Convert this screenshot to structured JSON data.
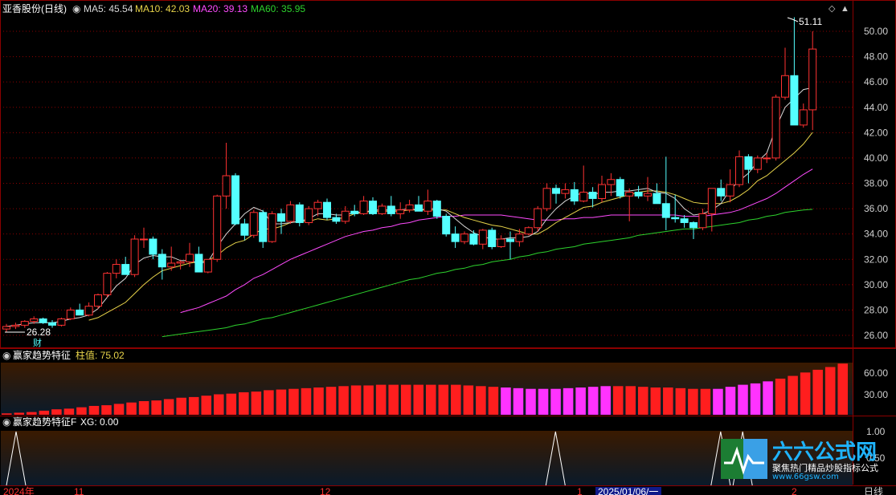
{
  "stock_name": "亚香股份(日线)",
  "colors": {
    "up": "#ff3232",
    "down": "#54ffff",
    "ma5": "#d8d8d8",
    "ma10": "#e8d44a",
    "ma20": "#ff4bff",
    "ma60": "#2dd22d",
    "grid": "#8b0000",
    "bar_red": "#ff1e1e",
    "bar_magenta": "#ff33ff"
  },
  "main_indicator": {
    "ma5_label": "MA5: 45.54",
    "ma10_label": "MA10: 42.03",
    "ma20_label": "MA20: 39.13",
    "ma60_label": "MA60: 35.95"
  },
  "price_axis": [
    "50.00",
    "48.00",
    "46.00",
    "44.00",
    "42.00",
    "40.00",
    "38.00",
    "36.00",
    "34.00",
    "32.00",
    "30.00",
    "28.00",
    "26.00"
  ],
  "high_marker": "51.11",
  "low_marker": "26.28",
  "caifu_label": "财",
  "panel2": {
    "title": "赢家趋势特征",
    "value_label": "柱值: 75.02",
    "axis": [
      "60.00",
      "30.00"
    ]
  },
  "panel3": {
    "title": "赢家趋势特征F",
    "value_label": "XG: 0.00",
    "axis": [
      "1.00",
      "0.50"
    ]
  },
  "time_axis": {
    "year": "2024年",
    "m11": "11",
    "m12": "12",
    "m1": "1",
    "current_date": "2025/01/06/一",
    "m2": "2",
    "period": "日线"
  },
  "brand": {
    "name": "六六公式网",
    "slogan": "聚焦热门精品炒股指标公式",
    "url": "www.66gsw.com"
  },
  "chart_data": {
    "type": "candlestick",
    "ohlc": [
      [
        26.5,
        26.9,
        26.28,
        26.7
      ],
      [
        26.7,
        27.0,
        26.5,
        26.8
      ],
      [
        26.8,
        27.2,
        26.6,
        27.1
      ],
      [
        27.1,
        27.5,
        26.9,
        27.3
      ],
      [
        27.3,
        27.4,
        26.9,
        27.0
      ],
      [
        27.0,
        27.2,
        26.6,
        26.8
      ],
      [
        26.8,
        27.4,
        26.7,
        27.3
      ],
      [
        27.3,
        28.2,
        27.2,
        28.0
      ],
      [
        28.0,
        28.5,
        27.8,
        27.6
      ],
      [
        27.6,
        28.6,
        27.5,
        28.3
      ],
      [
        28.3,
        29.3,
        28.1,
        29.2
      ],
      [
        29.2,
        31.0,
        29.0,
        30.9
      ],
      [
        30.9,
        32.0,
        30.5,
        31.6
      ],
      [
        31.6,
        32.2,
        31.0,
        30.8
      ],
      [
        30.8,
        33.9,
        30.6,
        33.6
      ],
      [
        33.6,
        34.5,
        32.9,
        33.6
      ],
      [
        33.6,
        33.8,
        32.0,
        32.4
      ],
      [
        32.4,
        32.8,
        30.4,
        31.4
      ],
      [
        31.4,
        33.0,
        31.1,
        31.7
      ],
      [
        31.7,
        31.9,
        31.2,
        31.8
      ],
      [
        31.8,
        33.3,
        31.4,
        32.4
      ],
      [
        32.4,
        33.0,
        31.2,
        31.0
      ],
      [
        31.0,
        32.0,
        30.9,
        32.0
      ],
      [
        32.0,
        37.1,
        31.8,
        37.0
      ],
      [
        37.0,
        41.2,
        36.0,
        38.6
      ],
      [
        38.6,
        38.8,
        34.7,
        34.8
      ],
      [
        34.8,
        35.2,
        33.5,
        33.9
      ],
      [
        33.9,
        35.9,
        33.7,
        35.7
      ],
      [
        35.7,
        35.9,
        32.9,
        33.4
      ],
      [
        33.4,
        35.8,
        33.3,
        35.6
      ],
      [
        35.6,
        36.0,
        34.0,
        35.0
      ],
      [
        35.0,
        36.6,
        34.8,
        36.3
      ],
      [
        36.3,
        36.5,
        34.6,
        34.9
      ],
      [
        34.9,
        36.2,
        34.7,
        36.0
      ],
      [
        36.0,
        36.7,
        35.4,
        36.5
      ],
      [
        36.5,
        36.8,
        35.1,
        35.3
      ],
      [
        35.3,
        35.6,
        34.8,
        35.0
      ],
      [
        35.0,
        36.2,
        34.8,
        35.8
      ],
      [
        35.8,
        36.3,
        35.4,
        35.6
      ],
      [
        35.6,
        37.0,
        35.5,
        36.6
      ],
      [
        36.6,
        36.9,
        35.5,
        35.6
      ],
      [
        35.6,
        36.4,
        35.5,
        36.2
      ],
      [
        36.2,
        37.0,
        35.4,
        35.6
      ],
      [
        35.6,
        36.5,
        35.2,
        35.9
      ],
      [
        35.9,
        36.7,
        35.7,
        36.3
      ],
      [
        36.3,
        37.0,
        35.8,
        35.8
      ],
      [
        35.8,
        37.5,
        35.5,
        36.6
      ],
      [
        36.6,
        36.7,
        35.2,
        35.4
      ],
      [
        35.4,
        35.6,
        33.8,
        34.0
      ],
      [
        34.0,
        34.6,
        32.9,
        33.4
      ],
      [
        33.4,
        34.2,
        33.2,
        34.0
      ],
      [
        34.0,
        34.3,
        33.1,
        33.2
      ],
      [
        33.2,
        34.4,
        32.8,
        34.3
      ],
      [
        34.3,
        34.5,
        32.8,
        33.0
      ],
      [
        33.0,
        33.9,
        32.9,
        33.6
      ],
      [
        33.6,
        34.2,
        32.0,
        33.4
      ],
      [
        33.4,
        34.4,
        33.0,
        34.0
      ],
      [
        34.0,
        34.6,
        33.9,
        34.5
      ],
      [
        34.5,
        36.2,
        34.2,
        36.0
      ],
      [
        36.0,
        38.0,
        35.8,
        37.6
      ],
      [
        37.6,
        37.9,
        36.4,
        37.2
      ],
      [
        37.2,
        38.0,
        36.8,
        37.5
      ],
      [
        37.5,
        38.1,
        36.3,
        36.6
      ],
      [
        36.6,
        39.4,
        36.5,
        37.3
      ],
      [
        37.3,
        37.7,
        36.1,
        36.8
      ],
      [
        36.8,
        38.6,
        36.5,
        37.9
      ],
      [
        37.9,
        38.8,
        37.0,
        38.3
      ],
      [
        38.3,
        38.5,
        36.8,
        37.0
      ],
      [
        37.0,
        37.6,
        35.0,
        37.3
      ],
      [
        37.3,
        37.8,
        36.8,
        37.0
      ],
      [
        37.0,
        38.5,
        36.6,
        37.2
      ],
      [
        37.2,
        38.0,
        36.4,
        36.4
      ],
      [
        36.4,
        40.1,
        34.3,
        35.3
      ],
      [
        35.3,
        37.1,
        34.9,
        35.2
      ],
      [
        35.2,
        35.5,
        34.5,
        34.9
      ],
      [
        34.9,
        35.0,
        33.6,
        34.5
      ],
      [
        34.5,
        36.0,
        34.3,
        35.6
      ],
      [
        35.6,
        37.5,
        34.2,
        37.6
      ],
      [
        37.6,
        38.3,
        36.6,
        37.0
      ],
      [
        37.0,
        39.1,
        36.5,
        37.9
      ],
      [
        37.9,
        40.6,
        37.7,
        40.1
      ],
      [
        40.1,
        40.3,
        38.0,
        39.1
      ],
      [
        39.1,
        40.2,
        38.8,
        40.0
      ],
      [
        40.0,
        40.4,
        39.6,
        40.0
      ],
      [
        40.0,
        45.0,
        39.8,
        44.8
      ],
      [
        44.8,
        48.7,
        44.6,
        46.5
      ],
      [
        46.5,
        51.11,
        42.7,
        42.6
      ],
      [
        42.6,
        44.3,
        42.4,
        43.8
      ],
      [
        43.8,
        50.0,
        42.2,
        48.6
      ]
    ],
    "ma5": [
      26.7,
      26.8,
      26.9,
      27.0,
      27.0,
      27.0,
      27.1,
      27.3,
      27.4,
      27.6,
      28.1,
      29.0,
      29.9,
      30.5,
      31.6,
      32.1,
      32.3,
      32.2,
      32.2,
      31.9,
      31.9,
      31.7,
      31.8,
      33.0,
      34.0,
      34.8,
      35.6,
      36.1,
      35.8,
      34.8,
      34.8,
      34.9,
      35.0,
      35.2,
      35.6,
      35.6,
      35.5,
      35.5,
      35.7,
      35.7,
      35.9,
      35.9,
      35.9,
      35.9,
      36.0,
      35.9,
      36.0,
      36.0,
      35.8,
      35.2,
      34.6,
      34.1,
      33.8,
      33.6,
      33.6,
      33.7,
      33.7,
      33.8,
      34.2,
      35.2,
      36.0,
      36.6,
      37.0,
      37.3,
      37.1,
      37.3,
      37.3,
      37.4,
      37.4,
      37.5,
      37.6,
      37.3,
      37.2,
      36.8,
      36.0,
      35.5,
      35.6,
      35.9,
      36.4,
      37.5,
      38.2,
      38.8,
      39.7,
      40.4,
      42.4,
      44.0,
      44.7,
      45.4,
      45.54
    ],
    "ma10": [
      null,
      null,
      null,
      null,
      null,
      null,
      null,
      null,
      null,
      27.2,
      27.4,
      27.8,
      28.2,
      28.6,
      29.3,
      30.0,
      30.6,
      31.1,
      31.3,
      31.5,
      31.7,
      31.8,
      31.9,
      32.3,
      32.9,
      33.3,
      33.5,
      34.0,
      34.4,
      34.4,
      34.6,
      34.9,
      35.0,
      35.0,
      35.2,
      35.1,
      35.2,
      35.3,
      35.6,
      35.7,
      35.8,
      35.8,
      35.8,
      35.8,
      35.9,
      35.9,
      35.9,
      35.9,
      35.9,
      35.6,
      35.3,
      35.1,
      34.9,
      34.7,
      34.6,
      34.4,
      34.2,
      34.0,
      34.0,
      34.4,
      34.9,
      35.3,
      35.7,
      36.1,
      36.2,
      36.5,
      36.7,
      36.9,
      37.1,
      37.3,
      37.4,
      37.4,
      37.3,
      37.1,
      36.8,
      36.5,
      36.4,
      36.4,
      36.4,
      36.6,
      37.0,
      37.5,
      38.2,
      38.6,
      39.2,
      39.8,
      40.4,
      41.1,
      42.03
    ],
    "ma20": [
      null,
      null,
      null,
      null,
      null,
      null,
      null,
      null,
      null,
      null,
      null,
      null,
      null,
      null,
      null,
      null,
      null,
      null,
      null,
      27.8,
      28.0,
      28.2,
      28.5,
      28.8,
      29.1,
      29.6,
      30.0,
      30.5,
      30.8,
      31.2,
      31.6,
      32.0,
      32.3,
      32.6,
      32.9,
      33.2,
      33.5,
      33.8,
      34.0,
      34.2,
      34.3,
      34.5,
      34.6,
      34.8,
      34.9,
      35.1,
      35.2,
      35.3,
      35.4,
      35.4,
      35.5,
      35.5,
      35.5,
      35.5,
      35.5,
      35.4,
      35.3,
      35.2,
      35.1,
      35.1,
      35.1,
      35.2,
      35.2,
      35.3,
      35.3,
      35.4,
      35.5,
      35.5,
      35.5,
      35.5,
      35.5,
      35.5,
      35.5,
      35.5,
      35.4,
      35.4,
      35.4,
      35.5,
      35.6,
      35.7,
      35.9,
      36.2,
      36.5,
      36.8,
      37.2,
      37.7,
      38.2,
      38.7,
      39.13
    ],
    "ma60": [
      null,
      null,
      null,
      null,
      null,
      null,
      null,
      null,
      null,
      null,
      null,
      null,
      null,
      null,
      null,
      null,
      null,
      25.9,
      26.0,
      26.1,
      26.2,
      26.3,
      26.4,
      26.5,
      26.6,
      26.8,
      26.9,
      27.1,
      27.3,
      27.4,
      27.6,
      27.8,
      28.0,
      28.2,
      28.4,
      28.6,
      28.8,
      29.0,
      29.2,
      29.4,
      29.6,
      29.8,
      30.0,
      30.2,
      30.4,
      30.5,
      30.7,
      30.9,
      31.0,
      31.2,
      31.3,
      31.5,
      31.6,
      31.8,
      31.9,
      32.0,
      32.2,
      32.3,
      32.5,
      32.6,
      32.8,
      32.9,
      33.0,
      33.2,
      33.3,
      33.4,
      33.5,
      33.6,
      33.7,
      33.9,
      34.0,
      34.1,
      34.2,
      34.3,
      34.4,
      34.4,
      34.5,
      34.6,
      34.7,
      34.8,
      34.9,
      35.1,
      35.2,
      35.4,
      35.5,
      35.7,
      35.8,
      35.9,
      35.95
    ],
    "bar_values": [
      2,
      3,
      4,
      6,
      8,
      9,
      11,
      13,
      14,
      16,
      18,
      20,
      21,
      23,
      25,
      26,
      28,
      30,
      31,
      33,
      34,
      36,
      37,
      38,
      39,
      40,
      41,
      42,
      43,
      43,
      44,
      44,
      44,
      44,
      44,
      44,
      44,
      43,
      42,
      41,
      40,
      39,
      38,
      38,
      38,
      39,
      40,
      41,
      42,
      42,
      42,
      41,
      40,
      40,
      39,
      38,
      38,
      38,
      41,
      44,
      46,
      49,
      53,
      57,
      62,
      66,
      70,
      75.02
    ],
    "bar_magenta_from": 40,
    "bar_magenta_to": 48,
    "bar_magenta2_from": 57,
    "bar_magenta2_to": 61,
    "signal_indices": [
      0,
      49,
      64,
      66
    ]
  }
}
